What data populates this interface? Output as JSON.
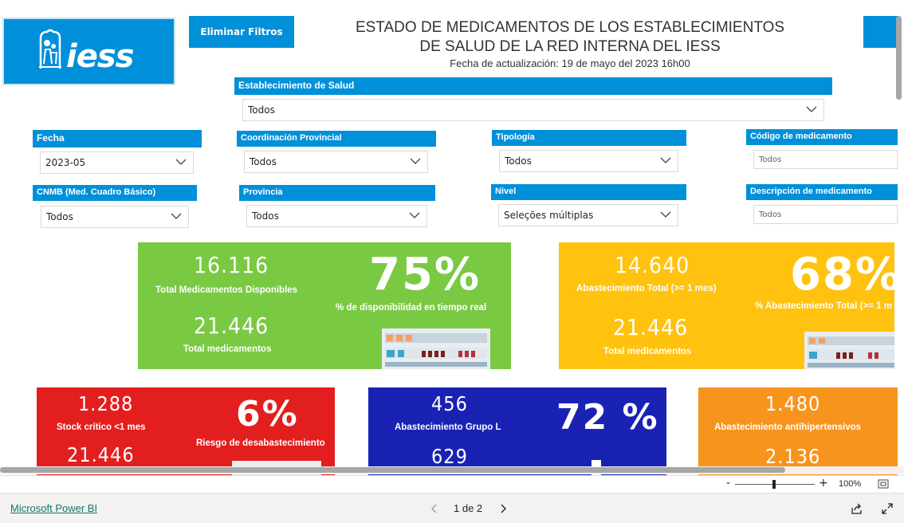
{
  "header": {
    "logo_text": "iess",
    "clear_filters_label": "Eliminar Filtros",
    "title_line1": "ESTADO DE MEDICAMENTOS DE LOS ESTABLECIMIENTOS",
    "title_line2": "DE SALUD DE LA RED INTERNA DEL IESS",
    "updated": "Fecha de actualización: 19 de mayo del 2023 16h00"
  },
  "slicers": {
    "establecimiento": {
      "label": "Establecimiento de Salud",
      "value": "Todos"
    },
    "fecha": {
      "label": "Fecha",
      "value": "2023-05"
    },
    "coordinacion": {
      "label": "Coordinación Provincial",
      "value": "Todos"
    },
    "tipologia": {
      "label": "Tipología",
      "value": "Todos"
    },
    "codigo": {
      "label": "Código de medicamento",
      "placeholder": "Todos"
    },
    "cnmb": {
      "label": "CNMB (Med. Cuadro Básico)",
      "value": "Todos"
    },
    "provincia": {
      "label": "Provincia",
      "value": "Todos"
    },
    "nivel": {
      "label": "Nivel",
      "value": "Seleções múltiplas"
    },
    "descripcion": {
      "label": "Descripción de medicamento",
      "placeholder": "Todos"
    }
  },
  "cards": {
    "disponibilidad": {
      "color": "#7ac943",
      "value1": "16.116",
      "label1": "Total Medicamentos Disponibles",
      "value2": "21.446",
      "label2": "Total medicamentos",
      "percent": "75%",
      "percent_label": "% de disponibilidad en tiempo real"
    },
    "abastecimiento": {
      "color": "#ffc20e",
      "value1": "14.640",
      "label1": "Abastecimiento Total (>= 1 mes)",
      "value2": "21.446",
      "label2": "Total medicamentos",
      "percent": "68%",
      "percent_label": "% Abastecimiento Total (>= 1 m"
    },
    "stock_critico": {
      "color": "#e31e1e",
      "value1": "1.288",
      "label1": "Stock crítico <1 mes",
      "value2": "21.446",
      "percent": "6%",
      "percent_label": "Riesgo de desabastecimiento"
    },
    "grupo_l": {
      "color": "#1a22b4",
      "value1": "456",
      "label1": "Abastecimiento Grupo L",
      "value2": "629",
      "percent": "72 %"
    },
    "antihipertensivos": {
      "color": "#f7941d",
      "value1": "1.480",
      "label1": "Abastecimiento antihipertensivos",
      "value2": "2.136"
    }
  },
  "footer": {
    "zoom_minus": "-",
    "zoom_plus": "+",
    "zoom_level": "100%",
    "powerbi_link": "Microsoft Power BI",
    "page_indicator": "1 de 2"
  }
}
